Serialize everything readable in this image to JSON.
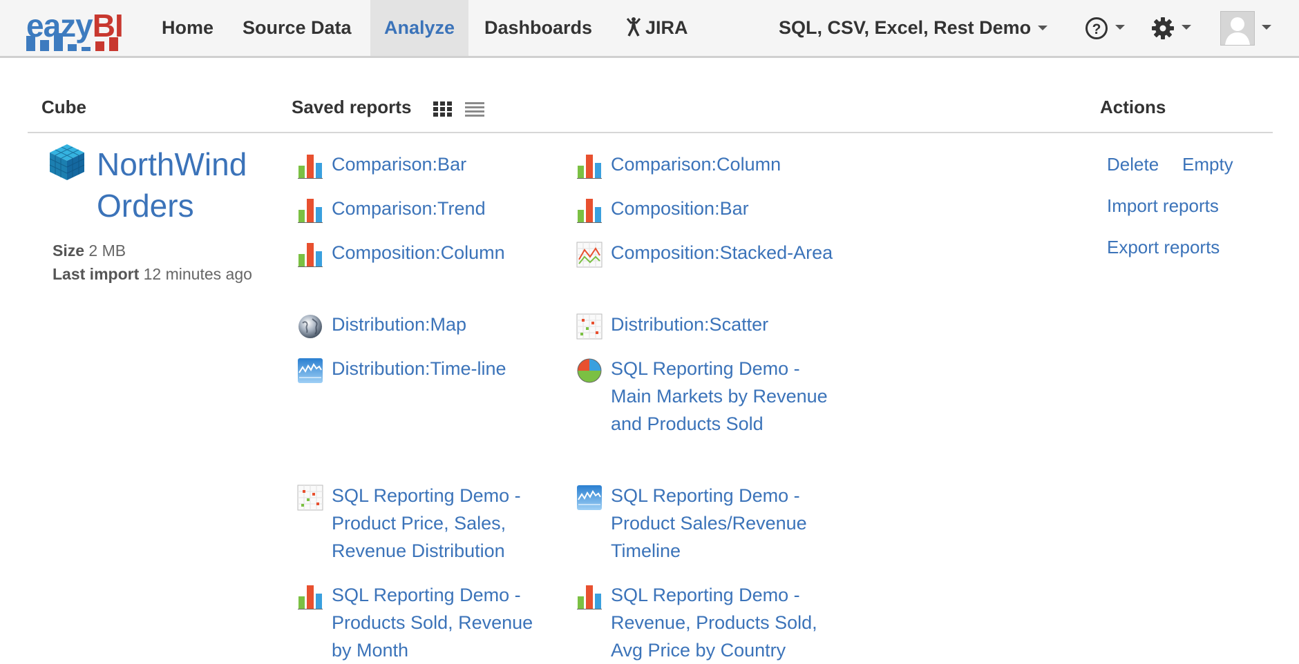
{
  "nav": {
    "logo_part1": "eazy",
    "logo_part2": "BI",
    "items": [
      "Home",
      "Source Data",
      "Analyze",
      "Dashboards",
      "JIRA"
    ],
    "account": "SQL, CSV, Excel, Rest Demo",
    "help_icon": "question-circle-icon",
    "settings_icon": "gear-icon",
    "user_icon": "avatar-icon"
  },
  "headers": {
    "cube": "Cube",
    "saved_reports": "Saved reports",
    "actions": "Actions"
  },
  "cube": {
    "name_line1": "NorthWind",
    "name_line2": "Orders",
    "size_label": "Size",
    "size_value": "2 MB",
    "last_import_label": "Last import",
    "last_import_value": "12 minutes ago"
  },
  "reports": [
    {
      "label": "Comparison:Bar",
      "icon": "bar-chart-icon"
    },
    {
      "label": "Comparison:Column",
      "icon": "bar-chart-icon"
    },
    {
      "label": "Comparison:Trend",
      "icon": "bar-chart-icon"
    },
    {
      "label": "Composition:Bar",
      "icon": "bar-chart-icon"
    },
    {
      "label": "Composition:Column",
      "icon": "bar-chart-icon"
    },
    {
      "label": "Composition:Stacked-Area",
      "icon": "line-chart-icon"
    },
    {
      "label": "Distribution:Map",
      "icon": "globe-icon"
    },
    {
      "label": "Distribution:Scatter",
      "icon": "scatter-chart-icon"
    },
    {
      "label": "Distribution:Time-line",
      "icon": "timeline-chart-icon"
    },
    {
      "label": "SQL Reporting Demo - Main Markets by Revenue and Products Sold",
      "icon": "pie-chart-icon"
    },
    {
      "label": "SQL Reporting Demo - Product Price, Sales, Revenue Distribution",
      "icon": "scatter-chart-icon"
    },
    {
      "label": "SQL Reporting Demo - Product Sales/Revenue Timeline",
      "icon": "timeline-chart-icon"
    },
    {
      "label": "SQL Reporting Demo - Products Sold, Revenue by Month",
      "icon": "bar-chart-icon"
    },
    {
      "label": "SQL Reporting Demo - Revenue, Products Sold, Avg Price by Country",
      "icon": "bar-chart-icon"
    }
  ],
  "actions": {
    "delete": "Delete",
    "empty": "Empty",
    "import": "Import reports",
    "export": "Export reports"
  },
  "colors": {
    "link": "#3b73b9",
    "logo_blue": "#3d7bbf",
    "logo_red": "#c8382f"
  }
}
